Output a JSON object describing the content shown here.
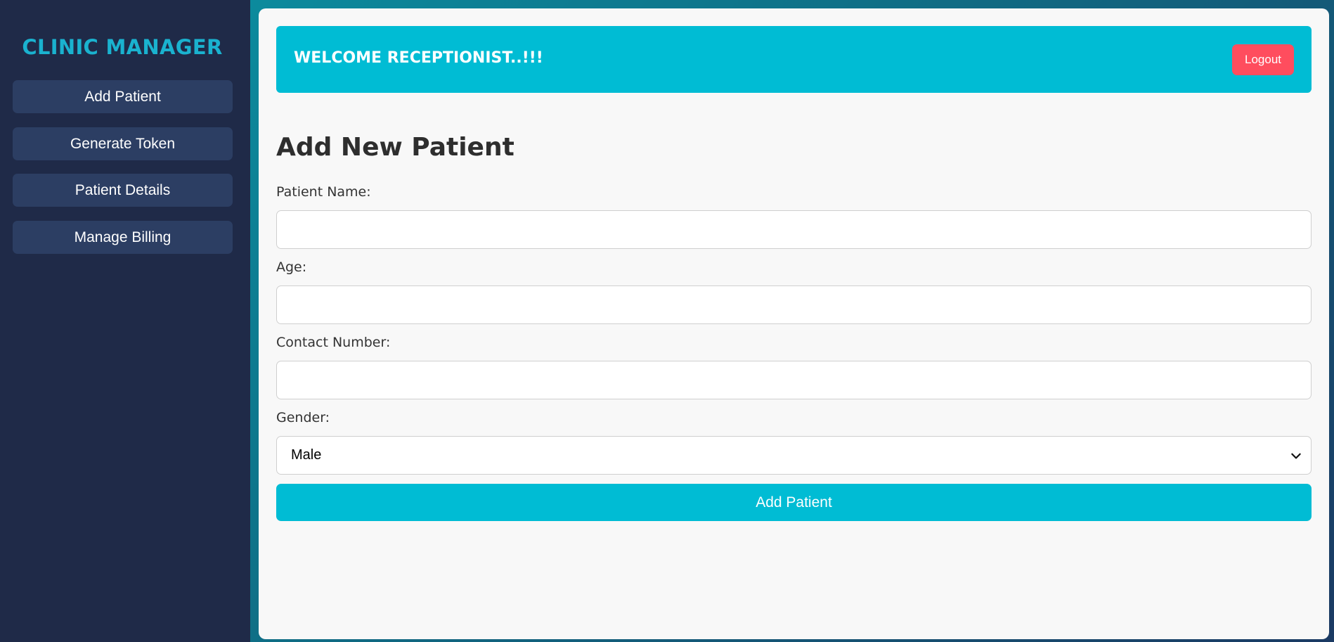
{
  "sidebar": {
    "brand": "CLINIC MANAGER",
    "items": [
      {
        "label": "Add Patient"
      },
      {
        "label": "Generate Token"
      },
      {
        "label": "Patient Details"
      },
      {
        "label": "Manage Billing"
      }
    ]
  },
  "header": {
    "welcome": "WELCOME RECEPTIONIST..!!!",
    "logout_label": "Logout"
  },
  "form": {
    "title": "Add New Patient",
    "patient_name_label": "Patient Name:",
    "patient_name_value": "",
    "age_label": "Age:",
    "age_value": "",
    "contact_label": "Contact Number:",
    "contact_value": "",
    "gender_label": "Gender:",
    "gender_selected": "Male",
    "submit_label": "Add Patient"
  },
  "colors": {
    "sidebar_bg": "#1f2a48",
    "nav_button_bg": "#2c3e63",
    "brand_text": "#1ab2cf",
    "accent": "#00bcd4",
    "logout": "#ff4d5e",
    "panel_bg": "#f8f8f8"
  },
  "icons": {
    "select_arrow": "chevron-down-icon"
  }
}
